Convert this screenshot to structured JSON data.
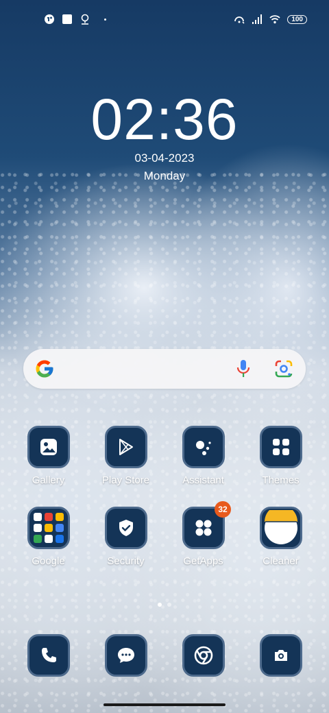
{
  "status_bar": {
    "left_icons": [
      "app-notification-icon",
      "square-notification-icon",
      "location-pin-icon"
    ],
    "right_icons": [
      "hotspot-icon",
      "signal-icon",
      "wifi-icon"
    ],
    "battery": "100"
  },
  "lockclock": {
    "time": "02:36",
    "date": "03-04-2023",
    "day": "Monday"
  },
  "search": {
    "logo": "google-g-icon",
    "mic": "microphone-icon",
    "lens": "google-lens-icon"
  },
  "apps": [
    {
      "label": "Gallery",
      "icon": "gallery-icon"
    },
    {
      "label": "Play Store",
      "icon": "play-store-icon"
    },
    {
      "label": "Assistant",
      "icon": "assistant-icon"
    },
    {
      "label": "Themes",
      "icon": "themes-icon"
    },
    {
      "label": "Google",
      "icon": "folder-icon"
    },
    {
      "label": "Security",
      "icon": "shield-check-icon"
    },
    {
      "label": "GetApps",
      "icon": "getapps-icon",
      "badge": "32"
    },
    {
      "label": "Cleaner",
      "icon": "cleaner-icon"
    }
  ],
  "dock": [
    {
      "icon": "phone-icon"
    },
    {
      "icon": "messages-icon"
    },
    {
      "icon": "chrome-icon"
    },
    {
      "icon": "camera-icon"
    }
  ],
  "colors": {
    "tile": "#143457",
    "tile_border": "#4d6a8c",
    "badge": "#e85a1c"
  }
}
